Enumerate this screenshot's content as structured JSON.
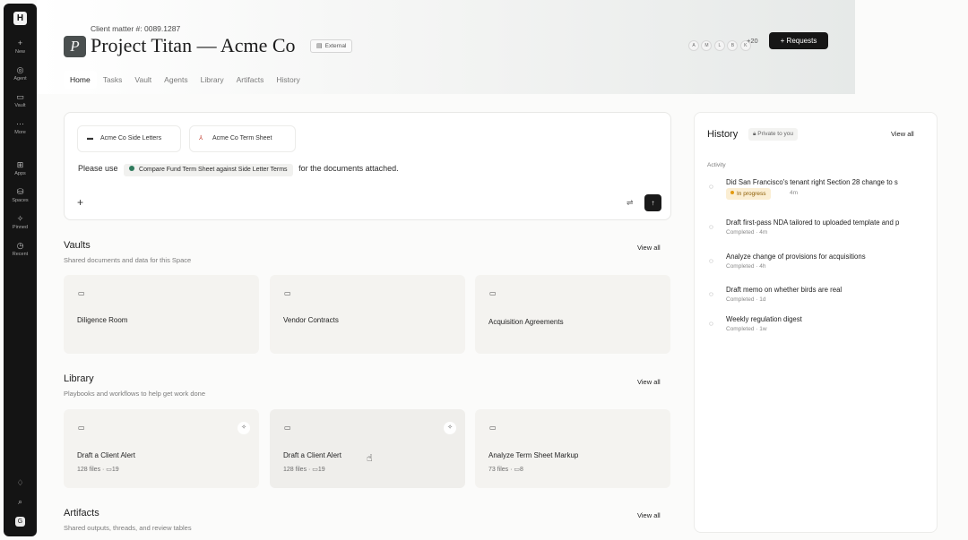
{
  "sidebar": {
    "logo": "H",
    "items": [
      {
        "icon": "plus-icon",
        "glyph": "+",
        "label": "New"
      },
      {
        "icon": "agent-icon",
        "glyph": "◎",
        "label": "Agent"
      },
      {
        "icon": "vault-icon",
        "glyph": "▭",
        "label": "Vault"
      },
      {
        "icon": "more-icon",
        "glyph": "···",
        "label": "More"
      },
      {
        "icon": "apps-icon",
        "glyph": "⊞",
        "label": "Apps"
      },
      {
        "icon": "spaces-icon",
        "glyph": "⛁",
        "label": "Spaces"
      },
      {
        "icon": "pin-icon",
        "glyph": "✧",
        "label": "Pinned"
      },
      {
        "icon": "recent-icon",
        "glyph": "◷",
        "label": "Recent"
      }
    ],
    "bottom": [
      {
        "icon": "bell-icon",
        "glyph": "♢"
      },
      {
        "icon": "search-icon",
        "glyph": "⌕"
      }
    ],
    "avatar": "G"
  },
  "header": {
    "matter": "Client matter #: 0089.1287",
    "badge_letter": "P",
    "title": "Project Titan — Acme Co",
    "tag": "External",
    "avatars": [
      "A",
      "M",
      "L",
      "B",
      "K"
    ],
    "extra_count": "+20",
    "requests_label": "+  Requests",
    "tabs": [
      "Home",
      "Tasks",
      "Vault",
      "Agents",
      "Library",
      "Artifacts",
      "History"
    ],
    "active_tab": "Home"
  },
  "prompt": {
    "docs": [
      {
        "icon": "folder-icon",
        "glyph": "▬",
        "name": "Acme Co Side Letters"
      },
      {
        "icon": "pdf-icon",
        "glyph": "⅄",
        "name": "Acme Co Term Sheet"
      }
    ],
    "prefix": "Please use",
    "workflow": "Compare Fund Term Sheet against Side Letter Terms",
    "suffix": "for the documents attached.",
    "plus": "+",
    "tune": "⇌",
    "send": "↑"
  },
  "vaults": {
    "title": "Vaults",
    "subtitle": "Shared documents and data for this Space",
    "view_all": "View all",
    "cards": [
      {
        "name": "Diligence Room"
      },
      {
        "name": "Vendor Contracts"
      },
      {
        "name": "Acquisition Agreements"
      }
    ]
  },
  "library": {
    "title": "Library",
    "subtitle": "Playbooks and workflows to help get work done",
    "view_all": "View all",
    "cards": [
      {
        "name": "Draft a Client Alert",
        "meta": "128 files · ▭19"
      },
      {
        "name": "Draft a Client Alert",
        "meta": "128 files · ▭19"
      },
      {
        "name": "Analyze Term Sheet Markup",
        "meta": "73 files · ▭8"
      }
    ]
  },
  "artifacts": {
    "title": "Artifacts",
    "subtitle": "Shared outputs, threads, and review tables",
    "view_all": "View all"
  },
  "history": {
    "title": "History",
    "private": "Private to you",
    "view_all": "View all",
    "activity_label": "Activity",
    "items": [
      {
        "title": "Did San Francisco's tenant right Section 28 change to s",
        "status": "In progress",
        "time": "4m"
      },
      {
        "title": "Draft first-pass NDA tailored to uploaded template and p",
        "status": "Completed · 4m"
      },
      {
        "title": "Analyze change of provisions for acquisitions",
        "status": "Completed · 4h"
      },
      {
        "title": "Draft memo on whether birds are real",
        "status": "Completed · 1d"
      },
      {
        "title": "Weekly regulation digest",
        "status": "Completed · 1w"
      }
    ]
  },
  "colors": {
    "sidebar_bg": "#141414",
    "card_bg": "#f4f3f0",
    "accent_green": "#2f7a5c",
    "in_progress": "#e29a12"
  }
}
